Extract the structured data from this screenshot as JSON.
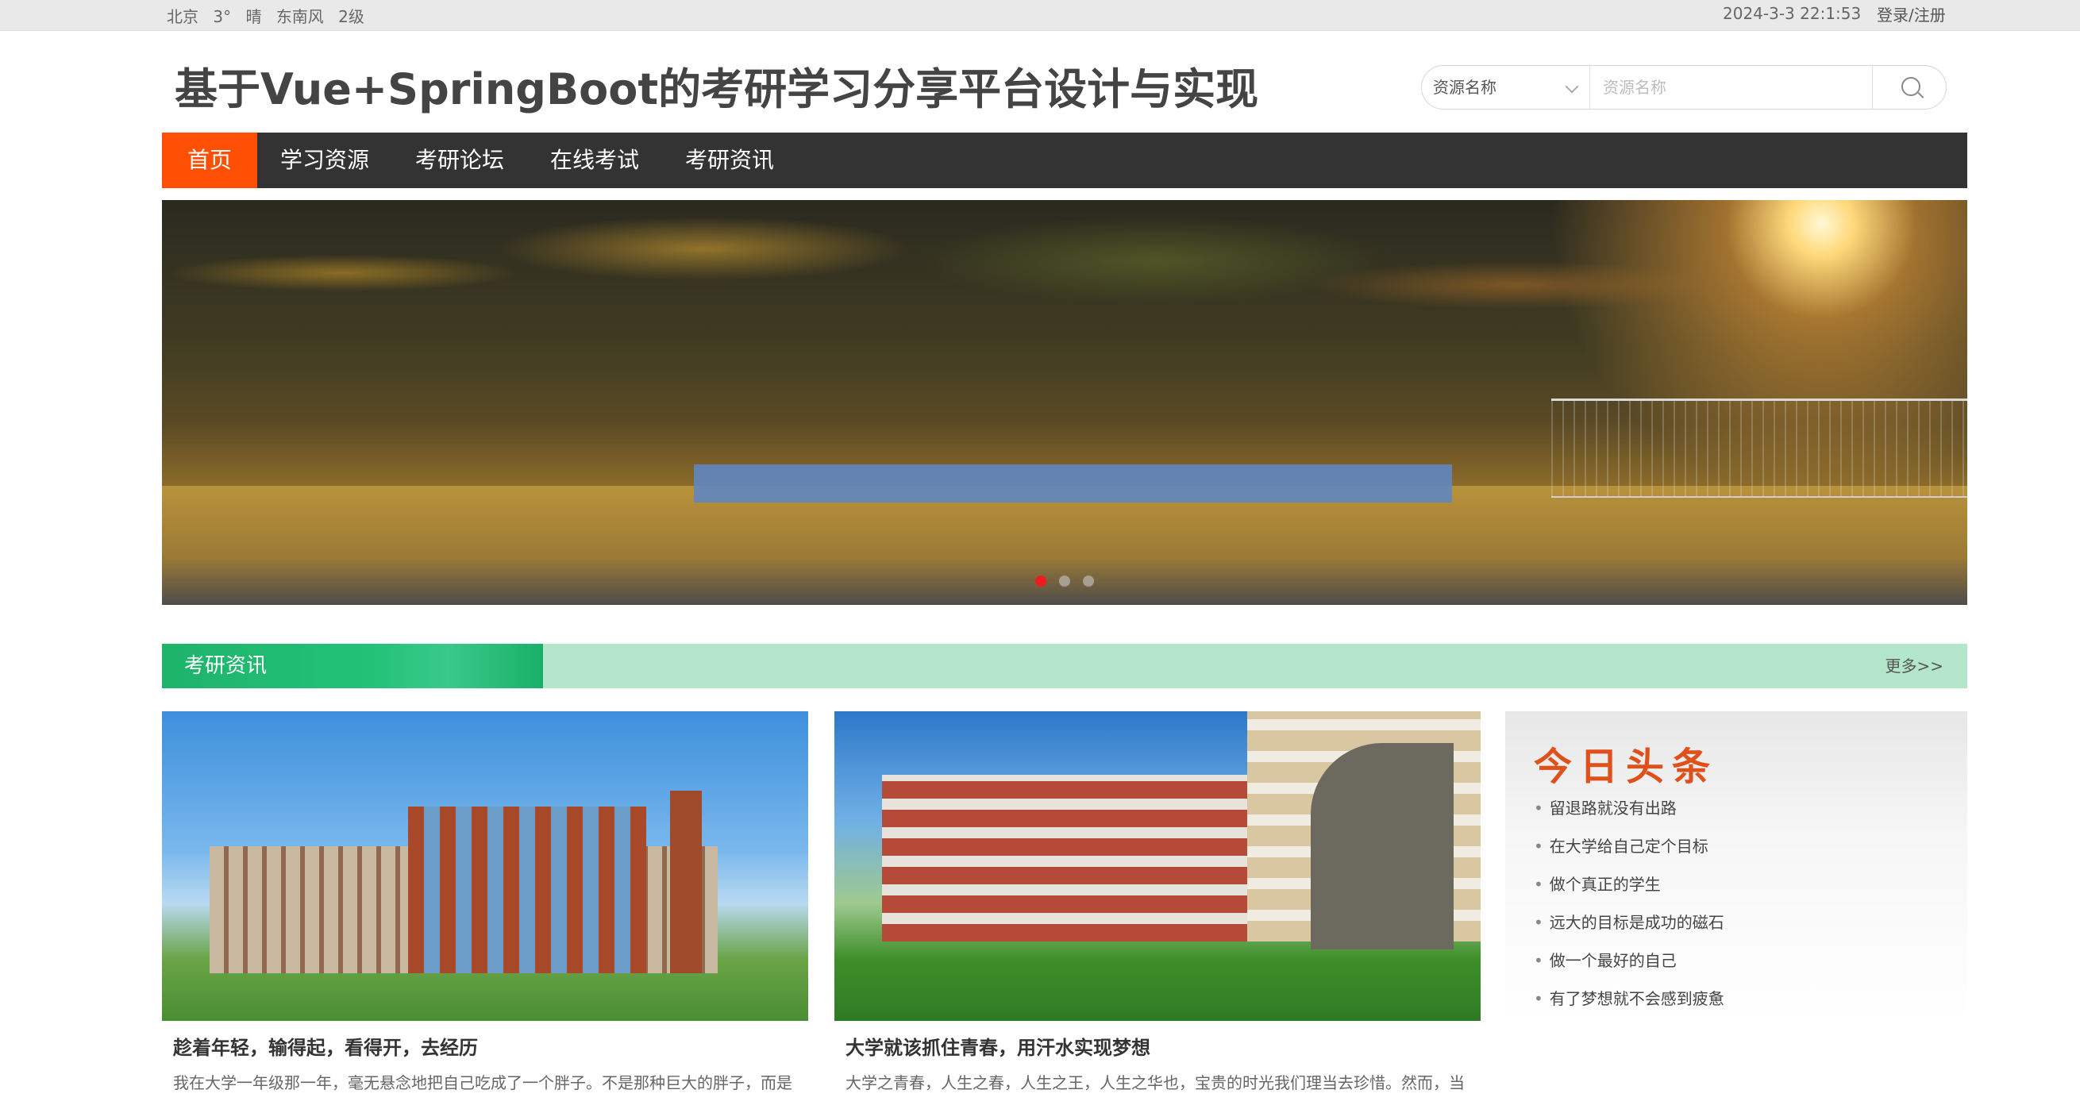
{
  "topbar": {
    "city": "北京",
    "temperature": "3°",
    "weather": "晴",
    "wind": "东南风",
    "wind_level": "2级",
    "datetime": "2024-3-3 22:1:53",
    "login_label": "登录/注册"
  },
  "header": {
    "title": "基于Vue+SpringBoot的考研学习分享平台设计与实现"
  },
  "search": {
    "select_value": "资源名称",
    "input_placeholder": "资源名称"
  },
  "nav": {
    "items": [
      {
        "label": "首页",
        "active": true
      },
      {
        "label": "学习资源",
        "active": false
      },
      {
        "label": "考研论坛",
        "active": false
      },
      {
        "label": "在线考试",
        "active": false
      },
      {
        "label": "考研资讯",
        "active": false
      }
    ]
  },
  "banner": {
    "slide_count": 3,
    "active_slide": 1
  },
  "section": {
    "title": "考研资讯",
    "more_label": "更多>>"
  },
  "articles": [
    {
      "title": "趁着年轻，输得起，看得开，去经历",
      "excerpt": "我在大学一年级那一年，毫无悬念地把自己吃成了一个胖子。不是那种巨大的胖子，而是"
    },
    {
      "title": "大学就该抓住青春，用汗水实现梦想",
      "excerpt": "大学之青春，人生之春，人生之王，人生之华也，宝贵的时光我们理当去珍惜。然而，当"
    }
  ],
  "headlines": {
    "logo_text": "今日头条",
    "items": [
      "留退路就没有出路",
      "在大学给自己定个目标",
      "做个真正的学生",
      "远大的目标是成功的磁石",
      "做一个最好的自己",
      "有了梦想就不会感到疲惫"
    ]
  },
  "colors": {
    "nav_bg": "#333333",
    "nav_active": "#ff4f04",
    "section_green": "#1eb46a",
    "section_bar": "#b3e6ca",
    "banner_dot_active": "#ee1d1d",
    "headline_logo": "#e0501a"
  }
}
